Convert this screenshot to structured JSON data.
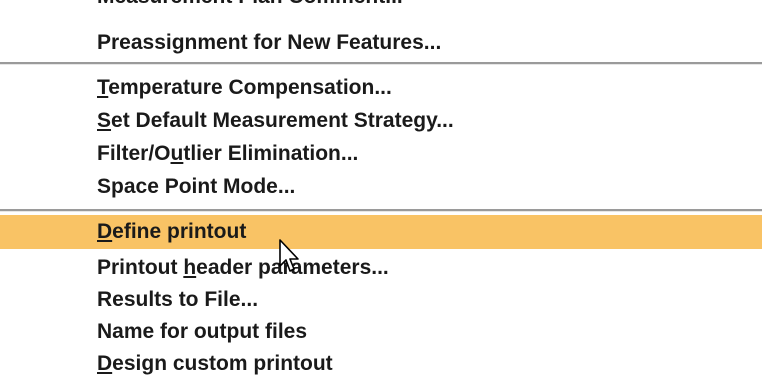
{
  "menu": {
    "group0": [
      {
        "label": "Measurement Plan Comment...",
        "underline": ""
      },
      {
        "label": "Preassignment for New Features...",
        "underline": ""
      }
    ],
    "group1": [
      {
        "label": "Temperature Compensation...",
        "underline": "T"
      },
      {
        "label": "Set Default Measurement Strategy...",
        "underline": "S"
      },
      {
        "label": "Filter/Outlier Elimination...",
        "underline": "u"
      },
      {
        "label": "Space Point Mode...",
        "underline": ""
      }
    ],
    "group2": [
      {
        "label": "Define printout",
        "underline": "D",
        "highlighted": true
      },
      {
        "label": "Printout header parameters...",
        "underline": "h"
      },
      {
        "label": "Results to File...",
        "underline": ""
      },
      {
        "label": "Name for output files",
        "underline": ""
      },
      {
        "label": "Design custom printout",
        "underline": "D"
      }
    ]
  },
  "colors": {
    "highlight": "#f9c365",
    "text": "#1a1a1a",
    "separator": "#9a9a9a"
  },
  "icons": {
    "cursor": "mouse-pointer-icon"
  }
}
